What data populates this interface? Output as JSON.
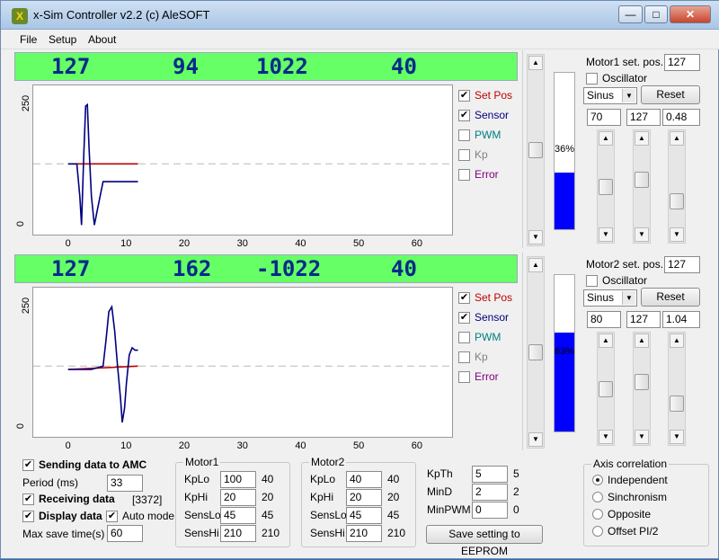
{
  "window": {
    "title": "x-Sim Controller v2.2 (c) AleSOFT"
  },
  "menu": [
    "File",
    "Setup",
    "About"
  ],
  "motor_panels": [
    {
      "lcd": [
        "127",
        "94",
        "1022",
        "40"
      ],
      "chart_data": {
        "type": "line",
        "ytick": "250",
        "ytick0": "0",
        "xticks": [
          "0",
          "10",
          "20",
          "30",
          "40",
          "50",
          "60"
        ],
        "xlim": [
          -6,
          66
        ],
        "ylim": [
          -20,
          290
        ],
        "reference": 127,
        "series": [
          {
            "name": "Set Pos",
            "color": "#c00000",
            "x": [
              0,
              12
            ],
            "y": [
              127,
              127
            ]
          },
          {
            "name": "Sensor",
            "color": "#000080",
            "x": [
              0,
              1.5,
              2,
              2.3,
              2.7,
              3,
              3.3,
              3.6,
              4,
              4.5,
              5,
              5.5,
              6,
              7,
              8,
              9,
              10,
              12
            ],
            "y": [
              127,
              127,
              60,
              0,
              150,
              247,
              250,
              160,
              60,
              0,
              30,
              60,
              90,
              90,
              90,
              90,
              90,
              90
            ]
          }
        ]
      },
      "legend": [
        "Set Pos",
        "Sensor",
        "PWM",
        "Kp",
        "Error"
      ],
      "legend_checked": [
        true,
        true,
        false,
        false,
        false
      ],
      "legend_colors": [
        "#c00000",
        "#000080",
        "#008080",
        "#808080",
        "#800080"
      ],
      "gauge_pct": 0.36,
      "gauge_label": "36%",
      "setpos_label": "Motor1 set. pos.",
      "setpos_value": "127",
      "osc_label": "Oscillator",
      "wave": "Sinus",
      "reset": "Reset",
      "osc_values": [
        "70",
        "127",
        "0.48"
      ],
      "slider_levels": [
        0.5,
        0.4,
        0.73
      ]
    },
    {
      "lcd": [
        "127",
        "162",
        "-1022",
        "40"
      ],
      "chart_data": {
        "type": "line",
        "ytick": "250",
        "ytick0": "0",
        "xticks": [
          "0",
          "10",
          "20",
          "30",
          "40",
          "50",
          "60"
        ],
        "xlim": [
          -6,
          66
        ],
        "ylim": [
          -20,
          290
        ],
        "reference": 127,
        "series": [
          {
            "name": "Set Pos",
            "color": "#c00000",
            "x": [
              0,
              12
            ],
            "y": [
              120,
              127
            ]
          },
          {
            "name": "Sensor",
            "color": "#000080",
            "x": [
              0,
              4,
              6,
              6.5,
              7,
              7.5,
              8,
              8.5,
              9,
              9.3,
              9.7,
              10,
              10.5,
              11,
              11.5,
              12
            ],
            "y": [
              120,
              120,
              127,
              180,
              240,
              250,
              200,
              127,
              60,
              10,
              40,
              90,
              150,
              165,
              160,
              160
            ]
          }
        ]
      },
      "legend": [
        "Set Pos",
        "Sensor",
        "PWM",
        "Kp",
        "Error"
      ],
      "legend_checked": [
        true,
        true,
        false,
        false,
        false
      ],
      "legend_colors": [
        "#c00000",
        "#000080",
        "#008080",
        "#808080",
        "#800080"
      ],
      "gauge_pct": 0.63,
      "gauge_label": "63%",
      "setpos_label": "Motor2 set. pos.",
      "setpos_value": "127",
      "osc_label": "Oscillator",
      "wave": "Sinus",
      "reset": "Reset",
      "osc_values": [
        "80",
        "127",
        "1.04"
      ],
      "slider_levels": [
        0.5,
        0.4,
        0.73
      ]
    }
  ],
  "bottom": {
    "sending": "Sending data to AMC",
    "period_label": "Period (ms)",
    "period_value": "33",
    "receiving": "Receiving data",
    "receiving_count": "[3372]",
    "display": "Display data",
    "automode": "Auto mode",
    "maxsave_label": "Max save time(s)",
    "maxsave_value": "60",
    "motor1": {
      "title": "Motor1",
      "rows": [
        {
          "label": "KpLo",
          "input": "100",
          "value": "40"
        },
        {
          "label": "KpHi",
          "input": "20",
          "value": "20"
        },
        {
          "label": "SensLo",
          "input": "45",
          "value": "45"
        },
        {
          "label": "SensHi",
          "input": "210",
          "value": "210"
        }
      ]
    },
    "motor2": {
      "title": "Motor2",
      "rows": [
        {
          "label": "KpLo",
          "input": "40",
          "value": "40"
        },
        {
          "label": "KpHi",
          "input": "20",
          "value": "20"
        },
        {
          "label": "SensLo",
          "input": "45",
          "value": "45"
        },
        {
          "label": "SensHi",
          "input": "210",
          "value": "210"
        }
      ]
    },
    "kp": [
      {
        "label": "KpTh",
        "input": "5",
        "value": "5"
      },
      {
        "label": "MinD",
        "input": "2",
        "value": "2"
      },
      {
        "label": "MinPWM",
        "input": "0",
        "value": "0"
      }
    ],
    "eeprom_button": "Save setting to EEPROM",
    "axis": {
      "title": "Axis correlation",
      "options": [
        "Independent",
        "Sinchronism",
        "Opposite",
        "Offset PI/2"
      ],
      "selected": 0
    }
  },
  "colors": {
    "lcd_bg": "#66ff66",
    "lcd_text": "#002a8a",
    "gauge": "#0000ff"
  }
}
